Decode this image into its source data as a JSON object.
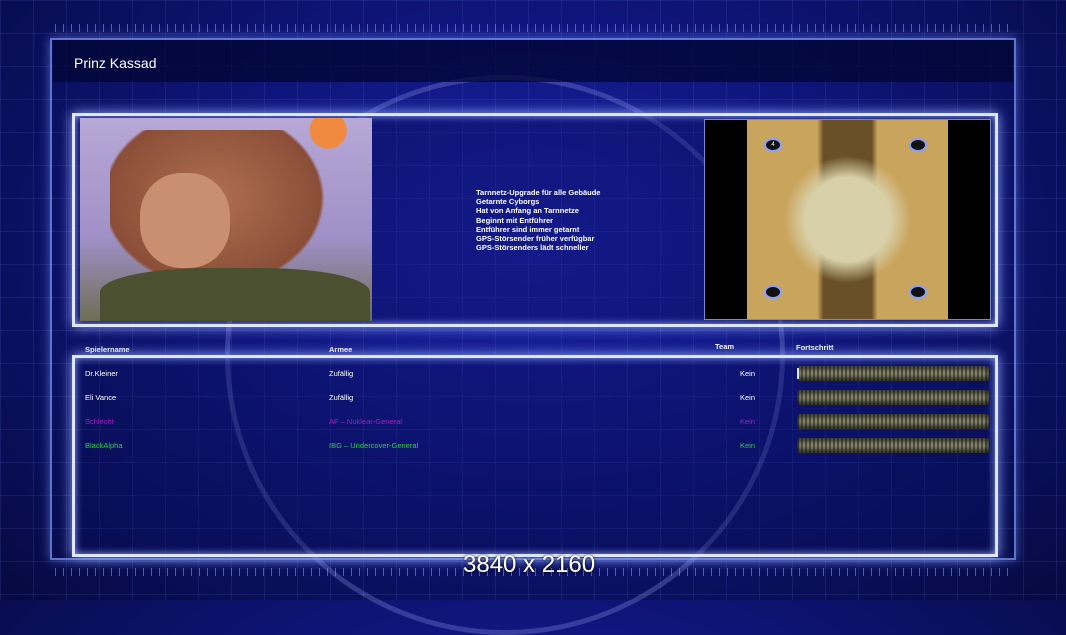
{
  "window": {
    "title": "Prinz Kassad"
  },
  "general": {
    "traits": [
      "Tarnnetz-Upgrade für alle Gebäude",
      "Getarnte Cyborgs",
      "Hat von Anfang an Tarnnetze",
      "Beginnt mit Entführer",
      "Entführer sind immer getarnt",
      "GPS-Störsender früher verfügbar",
      "GPS-Störsenders lädt schneller"
    ]
  },
  "map": {
    "start_marker": "4"
  },
  "table": {
    "headers": {
      "name": "Spielername",
      "army": "Armee",
      "team": "Team",
      "progress": "Fortschritt"
    },
    "rows": [
      {
        "name": "Dr.Kleiner",
        "army": "Zufällig",
        "team": "Kein",
        "color": "#ffffff",
        "progress": 0.01
      },
      {
        "name": "Eli Vance",
        "army": "Zufällig",
        "team": "Kein",
        "color": "#ffffff",
        "progress": 0
      },
      {
        "name": "Schlecht",
        "army": "AF – Nuklear-General",
        "team": "Kein",
        "color": "#a020c0",
        "progress": 0
      },
      {
        "name": "BlackAlpha",
        "army": "IBG – Undercover-General",
        "team": "Kein",
        "color": "#30d040",
        "progress": 0
      }
    ]
  },
  "overlay": {
    "resolution": "3840 x 2160"
  }
}
